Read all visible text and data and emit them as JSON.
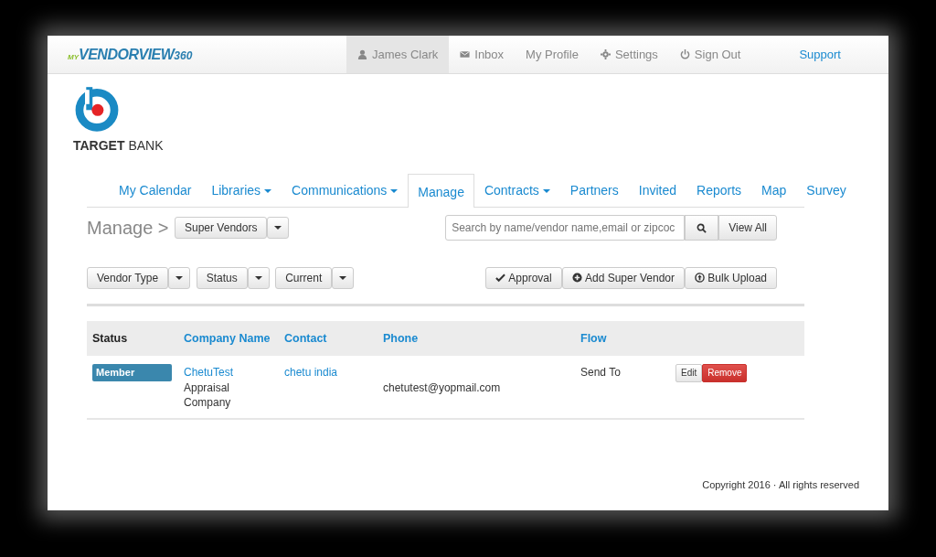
{
  "header": {
    "logo": {
      "prefix": "MY",
      "name": "VENDORVIEW",
      "suffix": "360"
    },
    "nav": [
      {
        "label": "James Clark",
        "kind": "menu",
        "selected": true
      },
      {
        "label": "Inbox",
        "kind": "menu",
        "selected": false
      },
      {
        "label": "My Profile",
        "kind": "menu",
        "selected": false
      },
      {
        "label": "Settings",
        "kind": "menu",
        "selected": false
      },
      {
        "label": "Sign Out",
        "kind": "menu",
        "selected": false
      },
      {
        "label": "Support",
        "kind": "link",
        "selected": false
      }
    ]
  },
  "bank": {
    "name": "**TARGET** BANK"
  },
  "tabs": [
    {
      "label": "My Calendar",
      "dropdown": false,
      "selected": false
    },
    {
      "label": "Libraries",
      "dropdown": true,
      "selected": false
    },
    {
      "label": "Communications",
      "dropdown": true,
      "selected": false
    },
    {
      "label": "Manage",
      "dropdown": false,
      "selected": true
    },
    {
      "label": "Contracts",
      "dropdown": true,
      "selected": false
    },
    {
      "label": "Partners",
      "dropdown": false,
      "selected": false
    },
    {
      "label": "Invited",
      "dropdown": false,
      "selected": false
    },
    {
      "label": "Reports",
      "dropdown": false,
      "selected": false
    },
    {
      "label": "Map",
      "dropdown": false,
      "selected": false
    },
    {
      "label": "Survey",
      "dropdown": false,
      "selected": false
    }
  ],
  "page_title": "Manage >",
  "view_select": "Super Vendors",
  "search": {
    "placeholder": "Search by name/vendor name,email or zipcoc",
    "button": "View All"
  },
  "filters": [
    "Vendor Type",
    "Status",
    "Current"
  ],
  "actions": [
    "Approval",
    "Add Super Vendor",
    "Bulk Upload"
  ],
  "table": {
    "columns": [
      {
        "label": "Status",
        "sortable": false
      },
      {
        "label": "Company Name",
        "sortable": true
      },
      {
        "label": "Contact",
        "sortable": true
      },
      {
        "label": "Phone",
        "sortable": true
      },
      {
        "label": "Flow",
        "sortable": true
      }
    ],
    "rows": [
      {
        "status": "Member",
        "company": "ChetuTest",
        "company_detail": "Appraisal Company",
        "contact": "chetu india",
        "phone": "chetutest@yopmail.com",
        "flow": "Send To",
        "edit": "Edit",
        "remove": "Remove"
      }
    ]
  },
  "footer": "Copyright 2016 · All rights reserved"
}
